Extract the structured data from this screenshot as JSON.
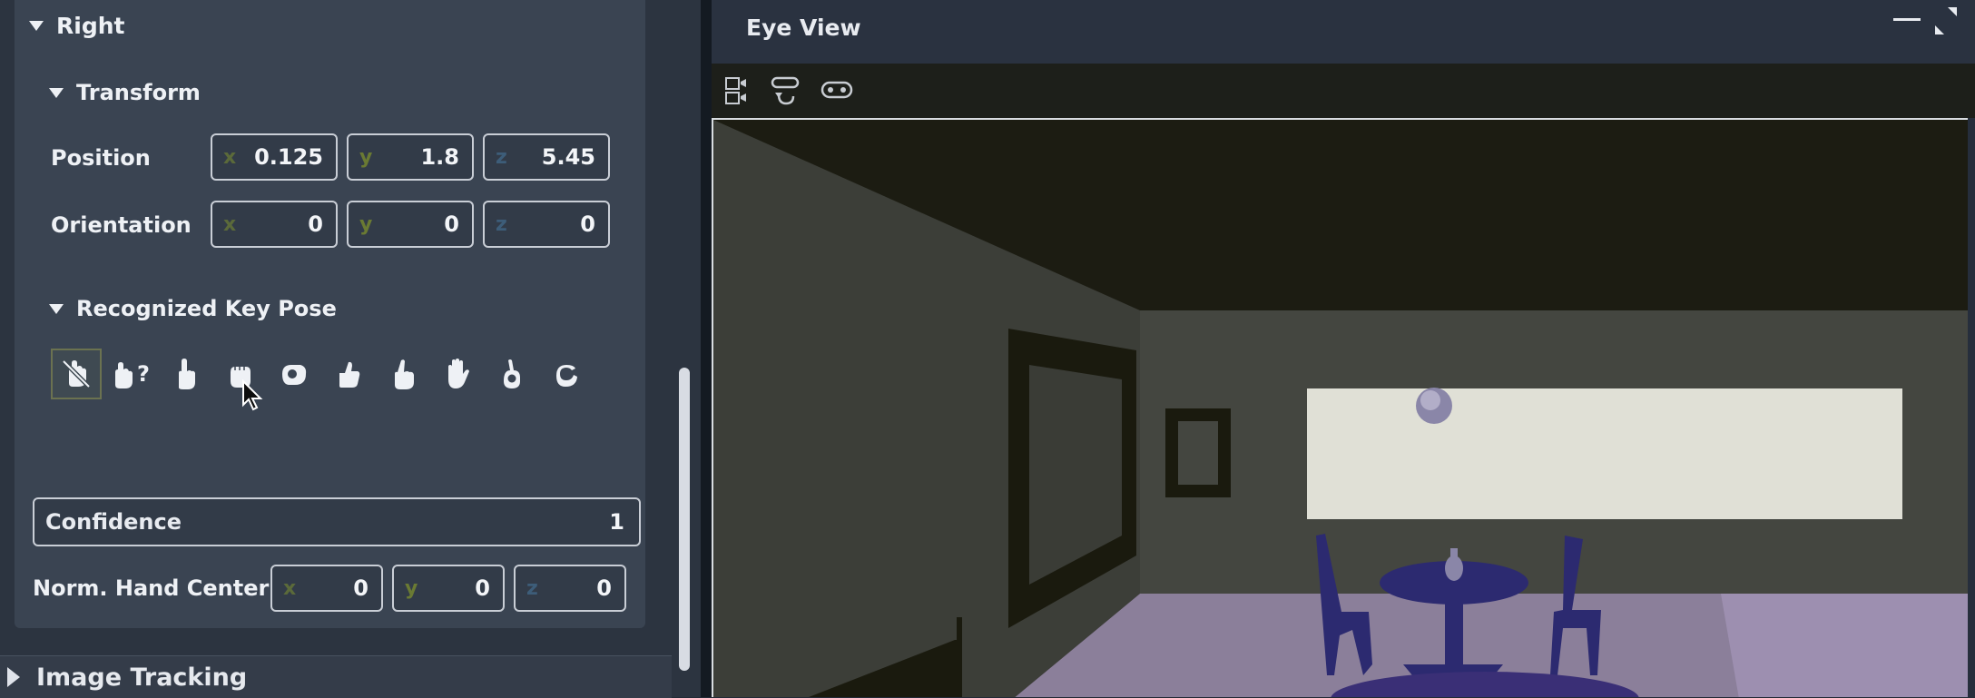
{
  "left_panel": {
    "section_title": "Right",
    "transform": {
      "title": "Transform",
      "position": {
        "label": "Position",
        "x": "0.125",
        "y": "1.8",
        "z": "5.45"
      },
      "orientation": {
        "label": "Orientation",
        "x": "0",
        "y": "0",
        "z": "0"
      }
    },
    "key_pose": {
      "title": "Recognized Key Pose",
      "poses": [
        "no-hand-icon",
        "unknown-pose-icon",
        "point-icon",
        "fist-icon",
        "ok-sign-icon",
        "thumbs-up-icon",
        "pinch-icon",
        "open-palm-icon",
        "victory-icon",
        "circle-gesture-icon"
      ],
      "unknown_suffix": "?"
    },
    "confidence": {
      "label": "Confidence",
      "value": "1"
    },
    "norm_hand_center": {
      "label": "Norm. Hand Center",
      "x": "0",
      "y": "0",
      "z": "0"
    },
    "axis_labels": {
      "x": "x",
      "y": "y",
      "z": "z"
    },
    "next_section": "Image Tracking"
  },
  "eye_view": {
    "title": "Eye View",
    "toolbar": [
      "camera-sides-icon",
      "rotate-headset-icon",
      "gamepad-icon"
    ]
  },
  "colors": {
    "panel": "#3a4452",
    "accent_border": "#c9ced6",
    "viewport_border": "#d8dce0"
  }
}
